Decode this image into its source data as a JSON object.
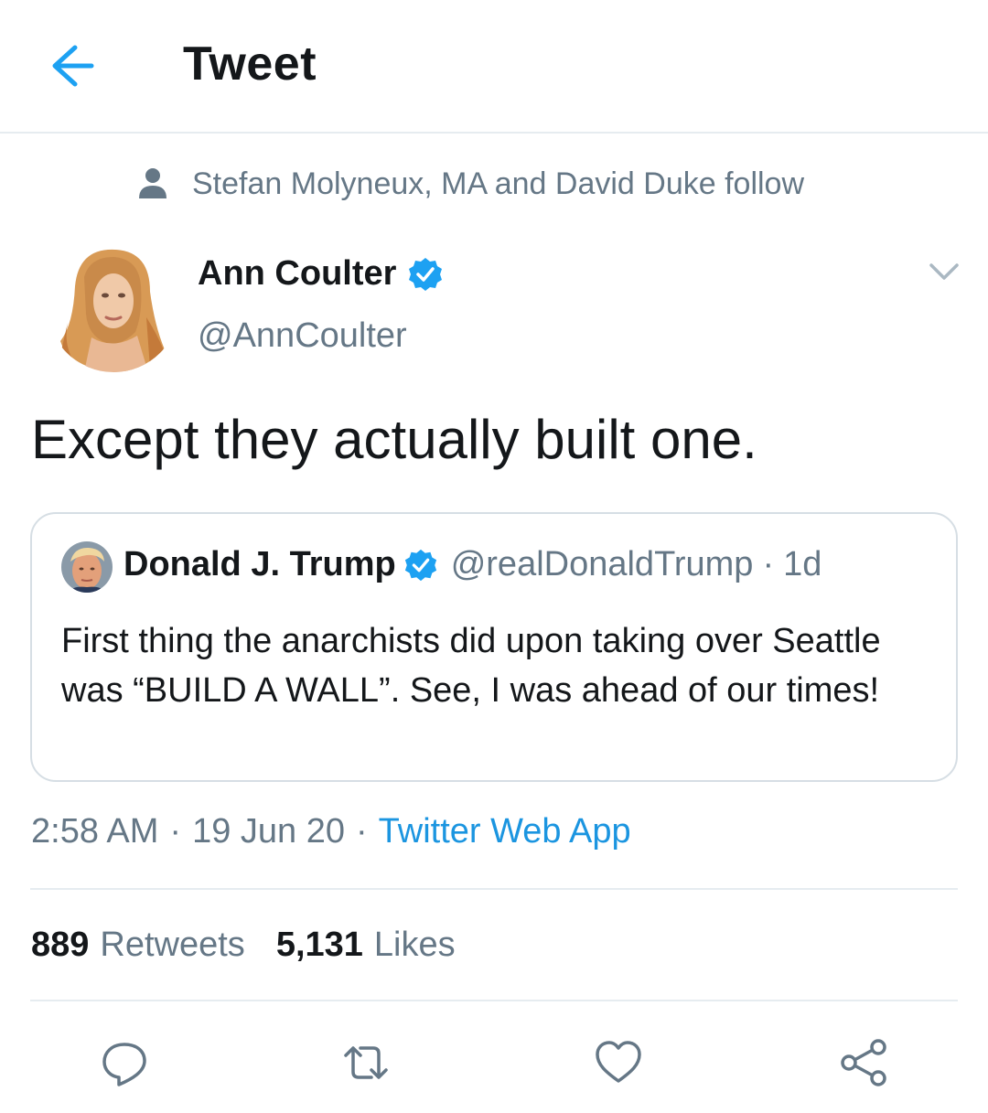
{
  "header": {
    "title": "Tweet",
    "back_icon": "arrow-left-icon",
    "accent_color": "#1da1f2"
  },
  "social_context": {
    "icon": "person-icon",
    "text": "Stefan Molyneux, MA and David Duke follow"
  },
  "tweet": {
    "author_name": "Ann Coulter",
    "author_handle": "@AnnCoulter",
    "verified": true,
    "text": "Except they actually built one.",
    "time": "2:58 AM",
    "date": "19 Jun 20",
    "source": "Twitter Web App",
    "separator": "·"
  },
  "quoted_tweet": {
    "author_name": "Donald J. Trump",
    "author_handle": "@realDonaldTrump",
    "verified": true,
    "separator": "·",
    "relative_time": "1d",
    "text": "First thing the anarchists did upon taking over Seattle was “BUILD A WALL”. See, I was ahead of our times!"
  },
  "stats": {
    "retweets_count": "889",
    "retweets_label": "Retweets",
    "likes_count": "5,131",
    "likes_label": "Likes"
  },
  "actions": [
    "reply-icon",
    "retweet-icon",
    "like-icon",
    "share-icon"
  ],
  "colors": {
    "text_primary": "#14171a",
    "text_secondary": "#657786",
    "link": "#1b95e0",
    "verified": "#1da1f2",
    "divider": "#e6ecf0"
  }
}
